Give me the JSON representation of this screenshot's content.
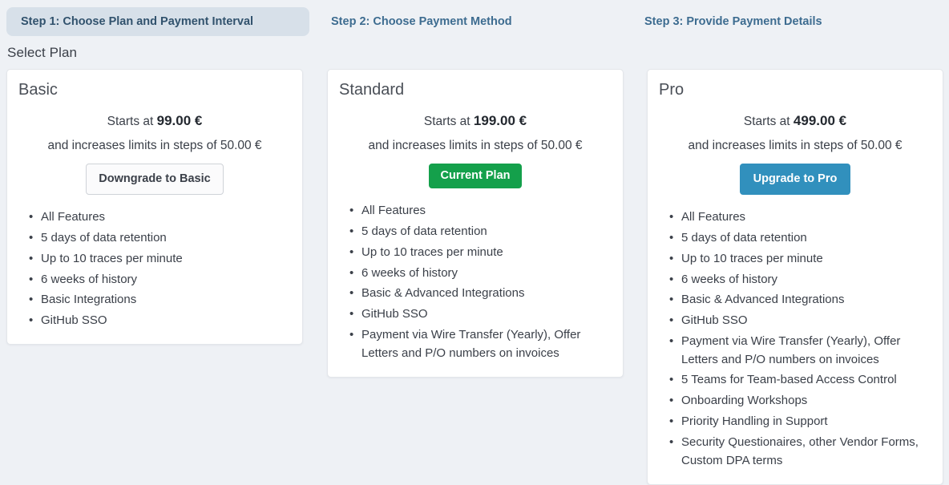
{
  "steps": [
    {
      "label": "Step 1: Choose Plan and Payment Interval",
      "active": true
    },
    {
      "label": "Step 2: Choose Payment Method",
      "active": false
    },
    {
      "label": "Step 3: Provide Payment Details",
      "active": false
    }
  ],
  "section": {
    "title": "Select Plan"
  },
  "colors": {
    "page_background": "#eef1f5",
    "active_step_background": "#d7e0e9",
    "step_text": "#3d6c90",
    "current_plan_green": "#14a04b",
    "upgrade_blue": "#3190bd",
    "card_border": "#e3e6ea"
  },
  "plans": [
    {
      "name": "Basic",
      "price_prefix": "Starts at",
      "price": "99.00 €",
      "increment_text": "and increases limits in steps of 50.00 €",
      "button": {
        "label": "Downgrade to Basic",
        "style": "outline"
      },
      "features": [
        "All Features",
        "5 days of data retention",
        "Up to 10 traces per minute",
        "6 weeks of history",
        "Basic Integrations",
        "GitHub SSO"
      ]
    },
    {
      "name": "Standard",
      "price_prefix": "Starts at",
      "price": "199.00 €",
      "increment_text": "and increases limits in steps of 50.00 €",
      "button": {
        "label": "Current Plan",
        "style": "current"
      },
      "features": [
        "All Features",
        "5 days of data retention",
        "Up to 10 traces per minute",
        "6 weeks of history",
        "Basic & Advanced Integrations",
        "GitHub SSO",
        "Payment via Wire Transfer (Yearly), Offer Letters and P/O numbers on invoices"
      ]
    },
    {
      "name": "Pro",
      "price_prefix": "Starts at",
      "price": "499.00 €",
      "increment_text": "and increases limits in steps of 50.00 €",
      "button": {
        "label": "Upgrade to Pro",
        "style": "upgrade"
      },
      "features": [
        "All Features",
        "5 days of data retention",
        "Up to 10 traces per minute",
        "6 weeks of history",
        "Basic & Advanced Integrations",
        "GitHub SSO",
        "Payment via Wire Transfer (Yearly), Offer Letters and P/O numbers on invoices",
        "5 Teams for Team-based Access Control",
        "Onboarding Workshops",
        "Priority Handling in Support",
        "Security Questionaires, other Vendor Forms, Custom DPA terms"
      ]
    }
  ]
}
